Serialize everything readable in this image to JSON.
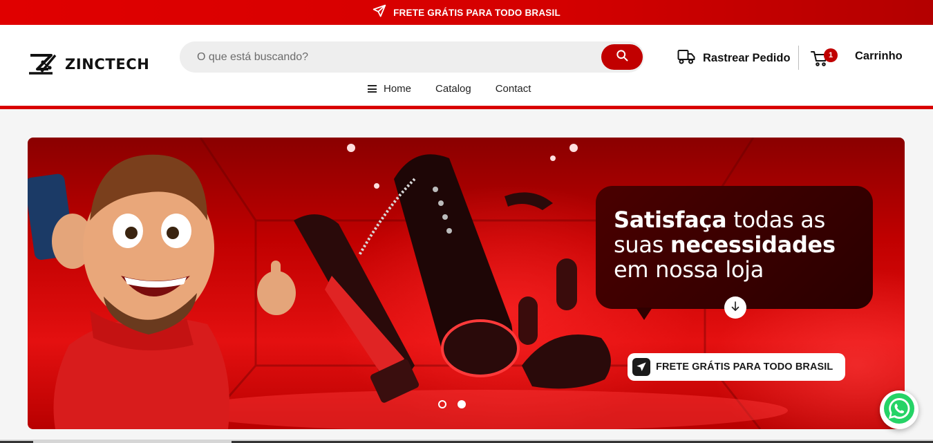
{
  "announcement": {
    "text": "FRETE GRÁTIS PARA TODO BRASIL",
    "icon": "paper-plane-icon"
  },
  "brand": {
    "name": "ZINCTECH",
    "primary_color": "#d90000",
    "dark_red": "#c10000"
  },
  "search": {
    "placeholder": "O que está buscando?",
    "value": "",
    "icon": "search-icon"
  },
  "header_actions": {
    "track_label": "Rastrear Pedido",
    "track_icon": "truck-icon",
    "cart_label": "Carrinho",
    "cart_icon": "cart-icon",
    "cart_count": "1"
  },
  "nav": {
    "items": [
      {
        "label": "Home",
        "icon": "menu-icon"
      },
      {
        "label": "Catalog"
      },
      {
        "label": "Contact"
      }
    ]
  },
  "banner": {
    "headline_line1_bold": "Satisfaça",
    "headline_line1_rest": " todas as",
    "headline_line2_start": "suas ",
    "headline_line2_bold": "necessidades",
    "headline_line3": "em nossa loja",
    "badge_text": "FRETE GRÁTIS PARA TODO BRASIL",
    "slide_count": 2,
    "active_slide": 2
  },
  "whatsapp": {
    "icon": "whatsapp-icon",
    "color": "#25d366"
  }
}
